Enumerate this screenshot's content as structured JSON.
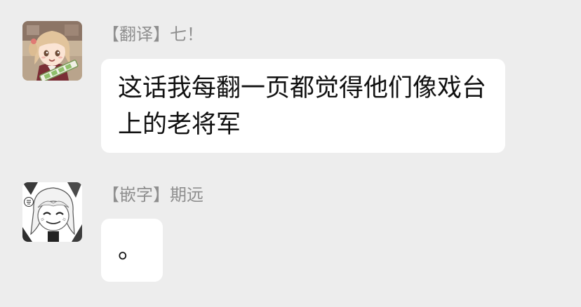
{
  "messages": [
    {
      "sender": "【翻译】七！",
      "text": "这话我每翻一页都觉得他们像戏台上的老将军",
      "avatar_icon": "anime-girl-holding-scroll-avatar"
    },
    {
      "sender": "【嵌字】期远",
      "text": "。",
      "avatar_icon": "manga-girl-smiling-avatar"
    }
  ],
  "colors": {
    "background": "#ededed",
    "bubble": "#ffffff",
    "sender_text": "#8f8f8f",
    "message_text": "#111111"
  }
}
